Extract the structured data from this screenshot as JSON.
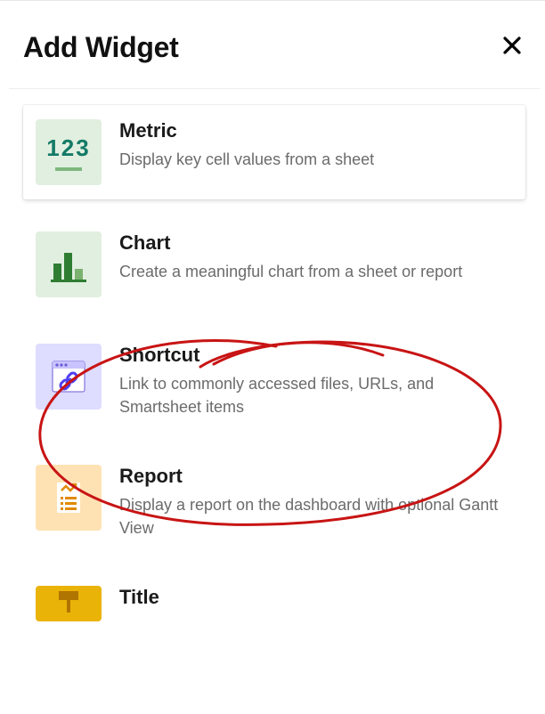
{
  "header": {
    "title": "Add Widget"
  },
  "widgets": [
    {
      "title": "Metric",
      "desc": "Display key cell values from a sheet"
    },
    {
      "title": "Chart",
      "desc": "Create a meaningful chart from a sheet or report"
    },
    {
      "title": "Shortcut",
      "desc": "Link to commonly accessed files, URLs, and Smartsheet items"
    },
    {
      "title": "Report",
      "desc": "Display a report on the dashboard with optional Gantt View"
    },
    {
      "title": "Title",
      "desc": ""
    }
  ]
}
